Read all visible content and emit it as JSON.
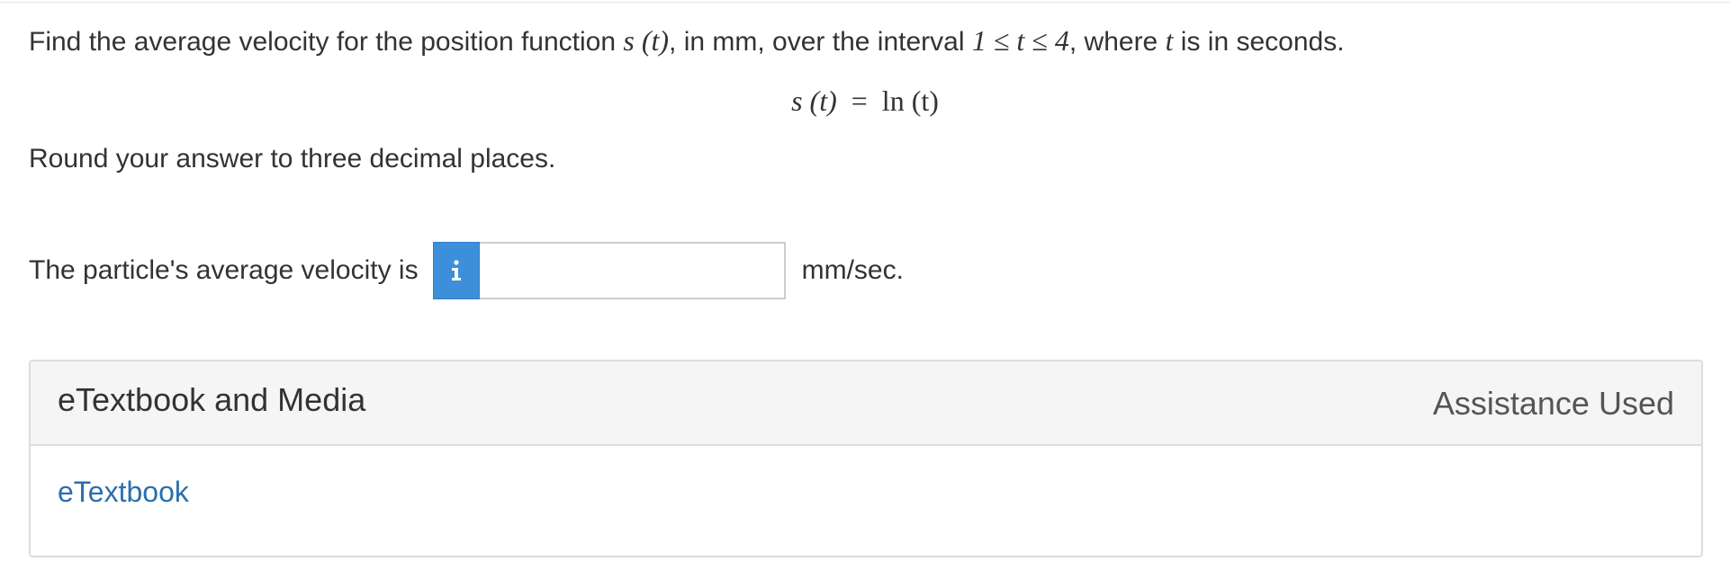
{
  "question": {
    "text_before": "Find the average velocity for the position function ",
    "fn": "s (t)",
    "text_units": ", in mm, over the interval ",
    "interval": "1 ≤ t ≤ 4",
    "text_where": ", where ",
    "var": "t",
    "text_after": " is in seconds."
  },
  "formula": {
    "lhs": "s (t)",
    "equals": "=",
    "rhs": "ln (t)"
  },
  "round_note": "Round your answer to three decimal places.",
  "answer": {
    "label": "The particle's average velocity is",
    "info_icon": "i",
    "value": "",
    "unit": "mm/sec."
  },
  "panel": {
    "title": "eTextbook and Media",
    "assistance": "Assistance Used",
    "link": "eTextbook"
  },
  "colors": {
    "info_button": "#3d8fd9",
    "link": "#2a6fad",
    "panel_header_bg": "#f5f5f5"
  },
  "icons": {
    "info": "info-icon"
  }
}
